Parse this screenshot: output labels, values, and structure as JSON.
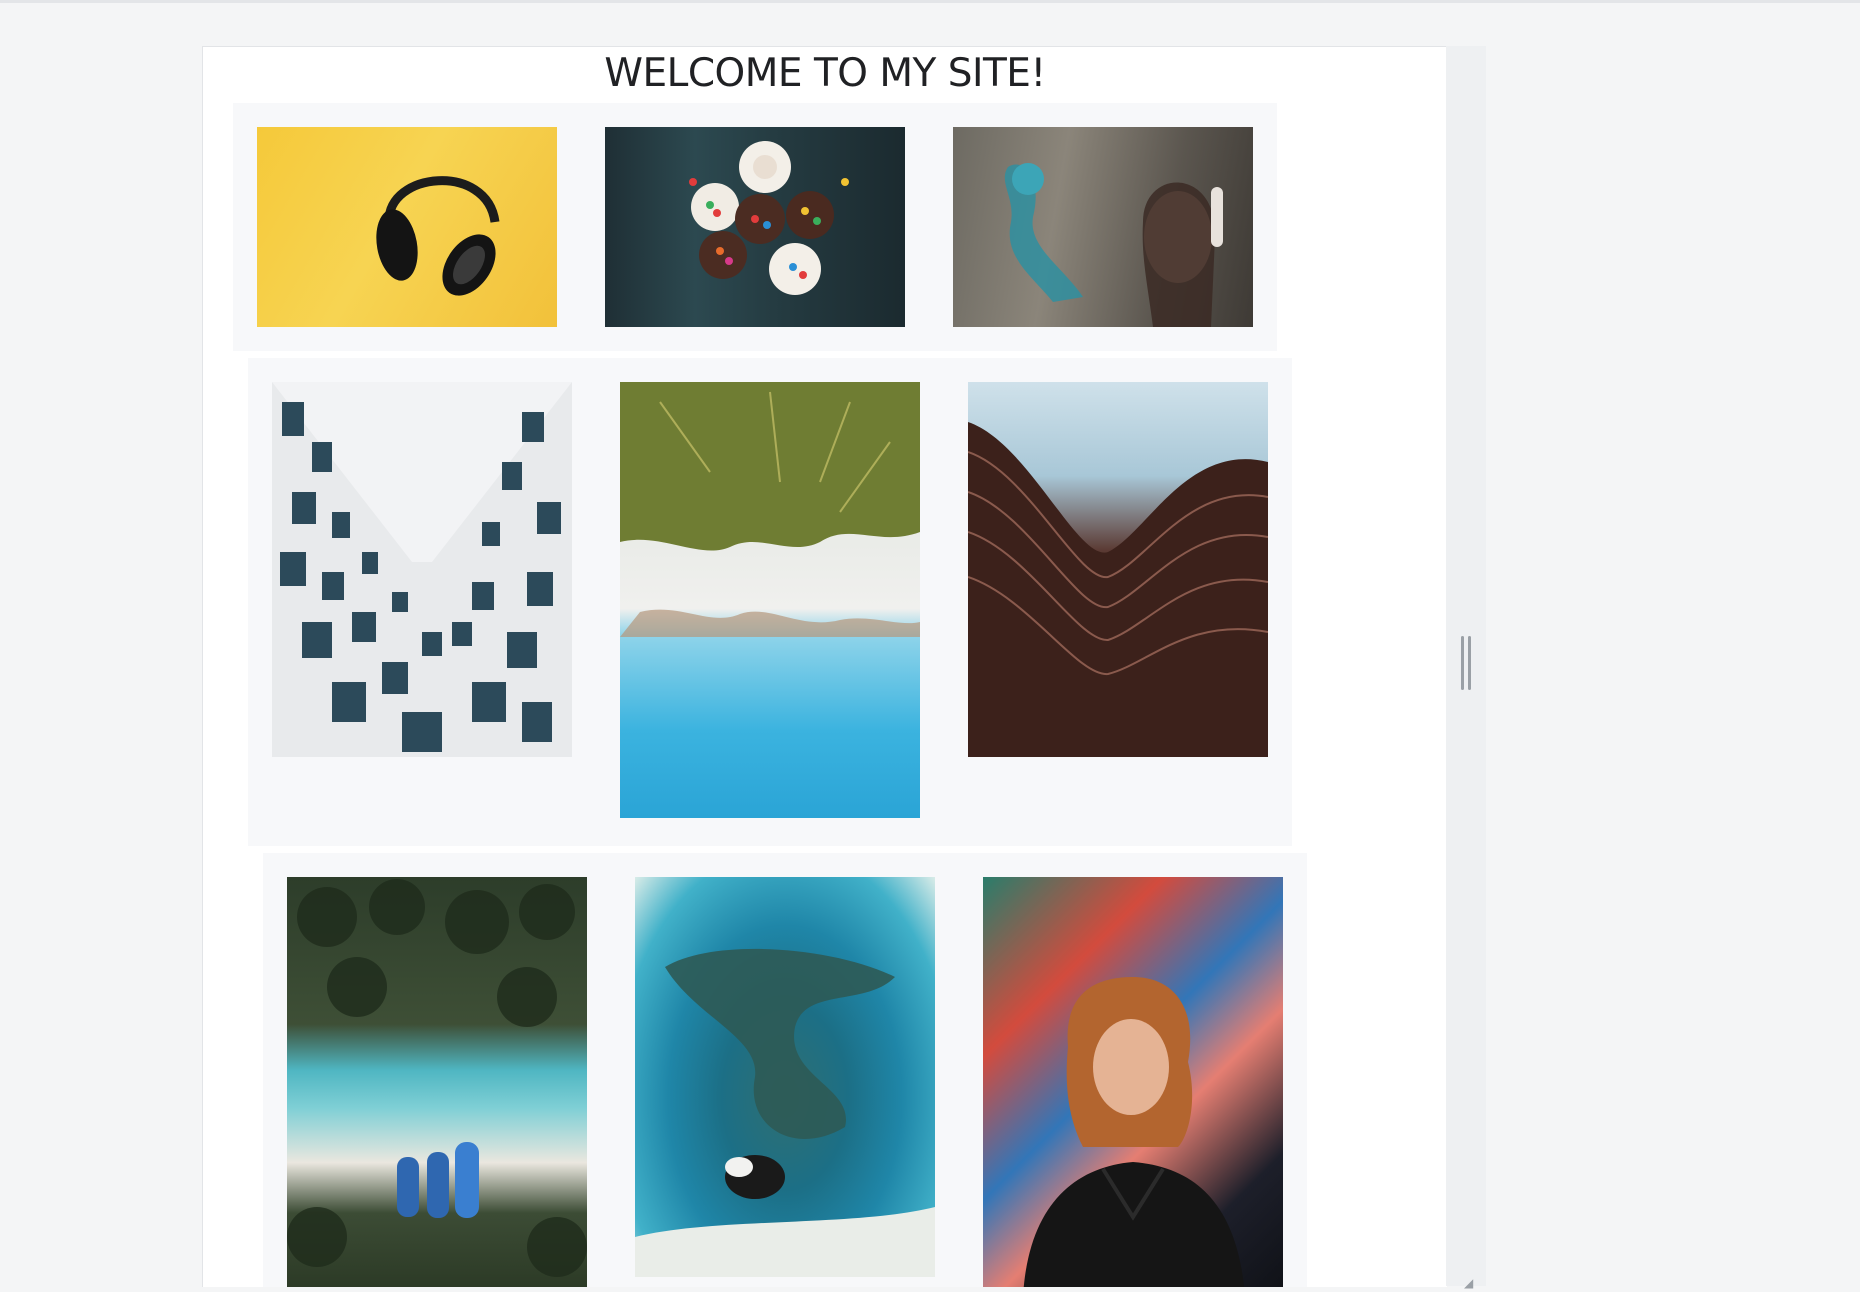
{
  "page": {
    "title": "WELCOME TO MY SITE!"
  },
  "gallery": {
    "rows": [
      {
        "photos": [
          {
            "icon": "headphones-photo"
          },
          {
            "icon": "cupcakes-photo"
          },
          {
            "icon": "street-art-photo"
          }
        ]
      },
      {
        "photos": [
          {
            "icon": "building-looking-up-photo"
          },
          {
            "icon": "palm-beach-aerial-photo"
          },
          {
            "icon": "curved-building-photo"
          }
        ]
      },
      {
        "photos": [
          {
            "icon": "palm-lagoon-aerial-photo"
          },
          {
            "icon": "reef-aerial-photo"
          },
          {
            "icon": "girl-graffiti-photo"
          }
        ]
      }
    ]
  },
  "colors": {
    "background": "#f4f5f6",
    "page": "#ffffff",
    "row_background": "#f7f8fa",
    "title": "#202124"
  }
}
